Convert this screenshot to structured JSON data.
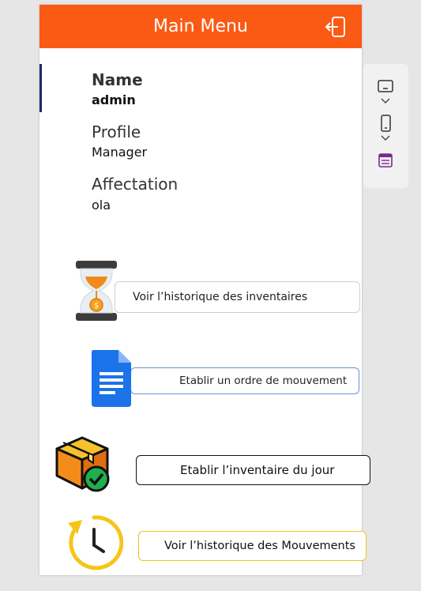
{
  "header": {
    "title": "Main Menu",
    "logout_icon": "logout-icon",
    "color": "#fb5a14"
  },
  "profile": {
    "name_label": "Name",
    "name_value": "admin",
    "profile_label": "Profile",
    "profile_value": "Manager",
    "affectation_label": "Affectation",
    "affectation_value": "ola"
  },
  "actions": [
    {
      "label": "Voir l’historique des inventaires",
      "icon": "hourglass-icon"
    },
    {
      "label": "Etablir un ordre de mouvement",
      "icon": "document-icon"
    },
    {
      "label": "Etablir l’inventaire du jour",
      "icon": "box-check-icon"
    },
    {
      "label": "Voir l’historique des Mouvements",
      "icon": "clock-history-icon"
    }
  ],
  "side_panel": {
    "icons": [
      "tablet-layout-icon",
      "chevron-down-icon",
      "phone-layout-icon",
      "chevron-down-icon",
      "form-icon"
    ]
  }
}
